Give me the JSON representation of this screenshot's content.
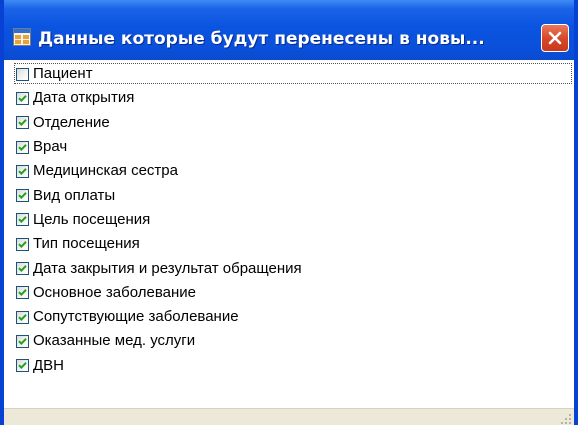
{
  "window": {
    "title": "Данные которые будут перенесены в новы..."
  },
  "checklist": {
    "items": [
      {
        "label": "Пациент",
        "checked": false,
        "focused": true
      },
      {
        "label": "Дата открытия",
        "checked": true
      },
      {
        "label": "Отделение",
        "checked": true
      },
      {
        "label": "Врач",
        "checked": true
      },
      {
        "label": "Медицинская сестра",
        "checked": true
      },
      {
        "label": "Вид оплаты",
        "checked": true
      },
      {
        "label": "Цель посещения",
        "checked": true
      },
      {
        "label": "Тип посещения",
        "checked": true
      },
      {
        "label": "Дата закрытия и результат обращения",
        "checked": true
      },
      {
        "label": "Основное заболевание",
        "checked": true
      },
      {
        "label": "Сопутствующие заболевание",
        "checked": true
      },
      {
        "label": "Оказанные мед. услуги",
        "checked": true
      },
      {
        "label": "ДВН",
        "checked": true
      }
    ]
  },
  "icons": {
    "app": "form-app-icon",
    "close": "close-icon",
    "check": "checkmark-icon",
    "grip": "resize-grip-icon"
  },
  "colors": {
    "titlebar": "#0a54e0",
    "close_button": "#d8492a",
    "checkmark": "#21a121",
    "status_bar": "#ece9d8"
  }
}
